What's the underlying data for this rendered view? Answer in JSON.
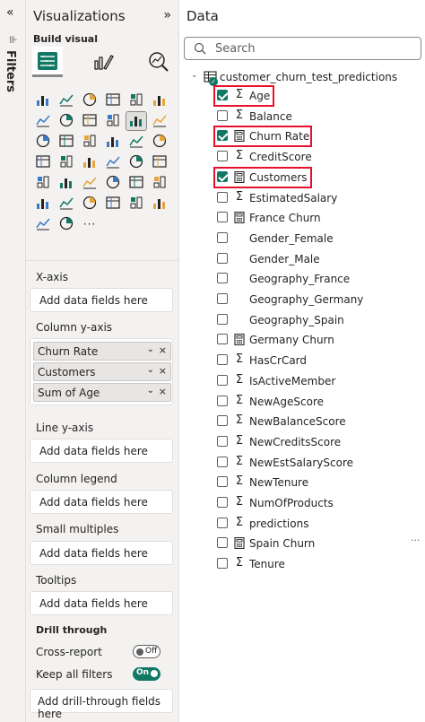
{
  "filters": {
    "collapse_glyph": "«",
    "label": "Filters"
  },
  "visualizations": {
    "title": "Visualizations",
    "collapse_glyph": "»",
    "build_visual": "Build visual",
    "more_label": "···",
    "x_axis": {
      "label": "X-axis",
      "placeholder": "Add data fields here"
    },
    "column_y_axis": {
      "label": "Column y-axis",
      "fields": [
        "Churn Rate",
        "Customers",
        "Sum of Age"
      ]
    },
    "line_y_axis": {
      "label": "Line y-axis",
      "placeholder": "Add data fields here"
    },
    "column_legend": {
      "label": "Column legend",
      "placeholder": "Add data fields here"
    },
    "small_multiples": {
      "label": "Small multiples",
      "placeholder": "Add data fields here"
    },
    "tooltips": {
      "label": "Tooltips",
      "placeholder": "Add data fields here"
    },
    "drill_through": {
      "label": "Drill through",
      "cross_report": {
        "label": "Cross-report",
        "state": "Off"
      },
      "keep_all_filters": {
        "label": "Keep all filters",
        "state": "On"
      },
      "placeholder": "Add drill-through fields here"
    }
  },
  "data_pane": {
    "title": "Data",
    "search_placeholder": "Search",
    "table": {
      "name": "customer_churn_test_predictions",
      "fields": [
        {
          "name": "Age",
          "type": "sigma",
          "checked": true,
          "highlighted": true
        },
        {
          "name": "Balance",
          "type": "sigma",
          "checked": false
        },
        {
          "name": "Churn Rate",
          "type": "calc",
          "checked": true,
          "highlighted": true
        },
        {
          "name": "CreditScore",
          "type": "sigma",
          "checked": false
        },
        {
          "name": "Customers",
          "type": "calc",
          "checked": true,
          "highlighted": true
        },
        {
          "name": "EstimatedSalary",
          "type": "sigma",
          "checked": false
        },
        {
          "name": "France Churn",
          "type": "calc",
          "checked": false
        },
        {
          "name": "Gender_Female",
          "type": "none",
          "checked": false
        },
        {
          "name": "Gender_Male",
          "type": "none",
          "checked": false
        },
        {
          "name": "Geography_France",
          "type": "none",
          "checked": false
        },
        {
          "name": "Geography_Germany",
          "type": "none",
          "checked": false
        },
        {
          "name": "Geography_Spain",
          "type": "none",
          "checked": false
        },
        {
          "name": "Germany Churn",
          "type": "calc",
          "checked": false
        },
        {
          "name": "HasCrCard",
          "type": "sigma",
          "checked": false
        },
        {
          "name": "IsActiveMember",
          "type": "sigma",
          "checked": false
        },
        {
          "name": "NewAgeScore",
          "type": "sigma",
          "checked": false
        },
        {
          "name": "NewBalanceScore",
          "type": "sigma",
          "checked": false
        },
        {
          "name": "NewCreditsScore",
          "type": "sigma",
          "checked": false
        },
        {
          "name": "NewEstSalaryScore",
          "type": "sigma",
          "checked": false
        },
        {
          "name": "NewTenure",
          "type": "sigma",
          "checked": false
        },
        {
          "name": "NumOfProducts",
          "type": "sigma",
          "checked": false
        },
        {
          "name": "predictions",
          "type": "sigma",
          "checked": false
        },
        {
          "name": "Spain Churn",
          "type": "calc",
          "checked": false,
          "more": "···"
        },
        {
          "name": "Tenure",
          "type": "sigma",
          "checked": false
        }
      ]
    }
  },
  "colors": {
    "accent": "#117865",
    "highlight": "#e8112d",
    "pane_bg": "#f3f2f1"
  }
}
